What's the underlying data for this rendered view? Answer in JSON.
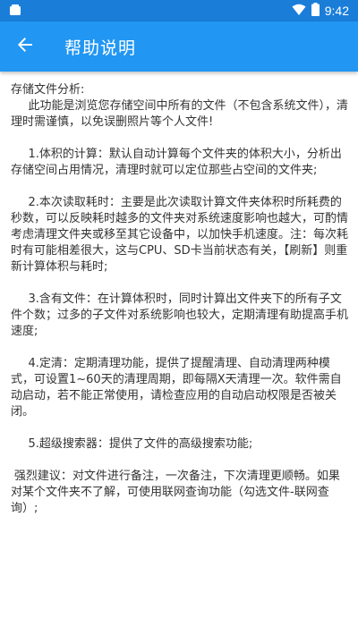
{
  "status_bar": {
    "time": "9:42",
    "icons": [
      "notification-icon",
      "wifi-icon",
      "battery-icon"
    ],
    "background": "#1a7ed9"
  },
  "app_bar": {
    "title": "帮助说明",
    "back_icon": "arrow-back-icon",
    "background": "#2196f3"
  },
  "help": {
    "heading": "存储文件分析:",
    "intro": "此功能是浏览您存储空间中所有的文件（不包含系统文件），清理时需谨慎，以免误删照片等个人文件!",
    "items": [
      "1.体积的计算：默认自动计算每个文件夹的体积大小，分析出存储空间占用情况，清理时就可以定位那些占空间的文件夹;",
      "2.本次读取耗时：主要是此次读取计算文件夹体积时所耗费的秒数，可以反映耗时越多的文件夹对系统速度影响也越大，可酌情考虑清理文件夹或移至其它设备中，以加快手机速度。注：每次耗时有可能相差很大，这与CPU、SD卡当前状态有关，【刷新】则重新计算体积与耗时;",
      "3.含有文件：在计算体积时，同时计算出文件夹下的所有子文件个数；过多的子文件对系统影响也较大，定期清理有助提高手机速度;",
      "4.定清：定期清理功能，提供了提醒清理、自动清理两种模式，可设置1~60天的清理周期，即每隔X天清理一次。软件需自动启动，若不能正常使用，请检查应用的自动启动权限是否被关闭。",
      "5.超级搜索器：提供了文件的高级搜索功能;"
    ],
    "suggestion": "强烈建议：对文件进行备注，一次备注，下次清理更顺畅。如果对某个文件夹不了解，可使用联网查询功能（勾选文件-联网查询）;"
  }
}
